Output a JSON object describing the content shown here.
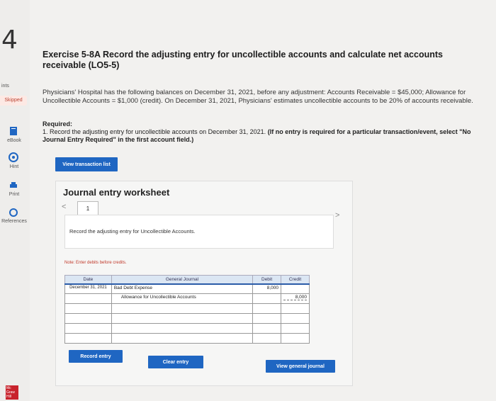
{
  "question_number": "4",
  "sidebar": {
    "points_label": "ints",
    "skipped_label": "Skipped",
    "ebook_label": "eBook",
    "hint_label": "Hint",
    "print_label": "Print",
    "references_label": "References",
    "logo_text": "Mc Graw Hill"
  },
  "exercise": {
    "title": "Exercise 5-8A Record the adjusting entry for uncollectible accounts and calculate net accounts receivable (LO5-5)",
    "paragraph": "Physicians' Hospital has the following balances on December 31, 2021, before any adjustment: Accounts Receivable = $45,000; Allowance for Uncollectible Accounts = $1,000 (credit). On December 31, 2021, Physicians' estimates uncollectible accounts to be 20% of accounts receivable.",
    "required_label": "Required:",
    "required_text": "1. Record the adjusting entry for uncollectible accounts on December 31, 2021.",
    "required_bold": "(If no entry is required for a particular transaction/event, select \"No Journal Entry Required\" in the first account field.)"
  },
  "buttons": {
    "view_transaction_list": "View transaction list",
    "record_entry": "Record entry",
    "clear_entry": "Clear entry",
    "view_general_journal": "View general journal"
  },
  "worksheet": {
    "title": "Journal entry worksheet",
    "prev": "<",
    "next": ">",
    "tab": "1",
    "instruction": "Record the adjusting entry for Uncollectible Accounts.",
    "note": "Note: Enter debits before credits.",
    "headers": {
      "date": "Date",
      "journal": "General Journal",
      "debit": "Debit",
      "credit": "Credit"
    },
    "rows": [
      {
        "date": "December 31, 2021",
        "account": "Bad Debt Expense",
        "debit": "8,000",
        "credit": ""
      },
      {
        "date": "",
        "account": "Allowance for Uncollectible Accounts",
        "debit": "",
        "credit": "8,000"
      },
      {
        "date": "",
        "account": "",
        "debit": "",
        "credit": ""
      },
      {
        "date": "",
        "account": "",
        "debit": "",
        "credit": ""
      },
      {
        "date": "",
        "account": "",
        "debit": "",
        "credit": ""
      },
      {
        "date": "",
        "account": "",
        "debit": "",
        "credit": ""
      }
    ]
  }
}
